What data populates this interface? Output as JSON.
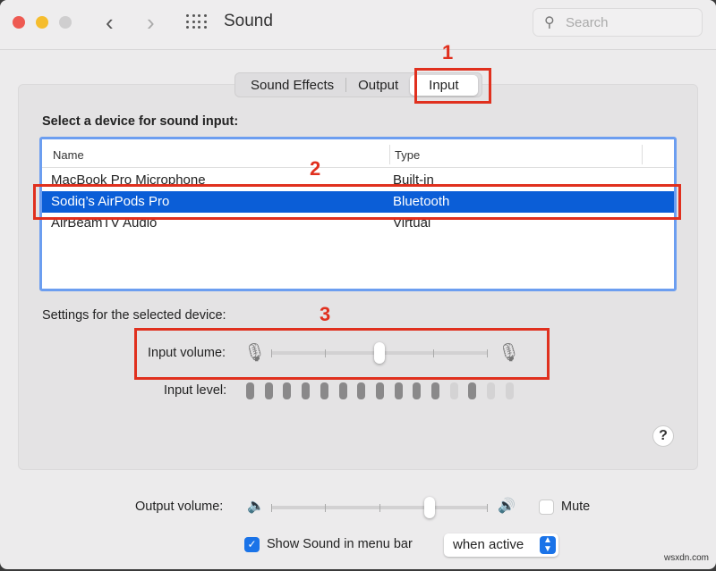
{
  "window": {
    "title": "Sound",
    "search_placeholder": "Search"
  },
  "tabs": [
    {
      "label": "Sound Effects"
    },
    {
      "label": "Output"
    },
    {
      "label": "Input",
      "selected": true
    }
  ],
  "device_heading": "Select a device for sound input:",
  "table": {
    "columns": [
      "Name",
      "Type"
    ],
    "rows": [
      {
        "name": "MacBook Pro Microphone",
        "type": "Built-in"
      },
      {
        "name": "Sodiq’s AirPods Pro",
        "type": "Bluetooth",
        "selected": true
      },
      {
        "name": "AirBeamTV Audio",
        "type": "Virtual"
      }
    ]
  },
  "settings_heading": "Settings for the selected device:",
  "input_volume": {
    "label": "Input volume:",
    "value": 0.5
  },
  "input_level": {
    "label": "Input level:",
    "bars": [
      1,
      1,
      1,
      1,
      1,
      1,
      1,
      1,
      1,
      1,
      1,
      0,
      1,
      0,
      0
    ]
  },
  "output_volume": {
    "label": "Output volume:",
    "value": 0.73
  },
  "mute": {
    "label": "Mute",
    "checked": false
  },
  "menu_bar": {
    "label": "Show Sound in menu bar",
    "checked": true,
    "option": "when active"
  },
  "help_label": "?",
  "annotations": [
    "1",
    "2",
    "3"
  ],
  "annotation_color": "#e0301e",
  "accent_color": "#0b5ed7",
  "watermark": "wsxdn.com"
}
